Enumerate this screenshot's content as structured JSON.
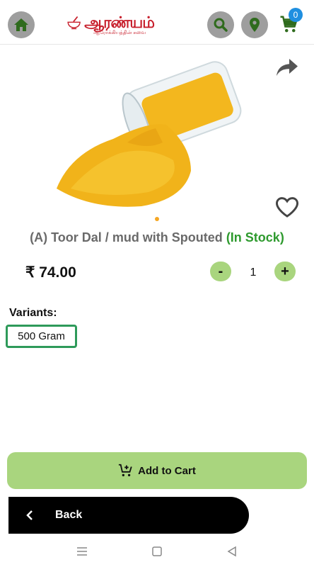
{
  "header": {
    "logo_text": "ஆரண்யம்",
    "logo_tagline": "ஆரோக்கியத்தின் சுவை",
    "cart_count": "0"
  },
  "product": {
    "title": "(A) Toor Dal / mud with Spouted",
    "stock": "(In Stock)",
    "price": "₹ 74.00",
    "quantity": "1",
    "minus_label": "-",
    "plus_label": "+"
  },
  "variants": {
    "label": "Variants:",
    "options": [
      "500 Gram"
    ]
  },
  "actions": {
    "add_to_cart": "Add to Cart",
    "back": "Back"
  },
  "colors": {
    "accent_green": "#a9d57e",
    "stock_green": "#2e9a2e",
    "brand_red": "#c71e2b",
    "badge_blue": "#1f8fe0"
  },
  "icons": [
    "home-icon",
    "search-icon",
    "location-pin-icon",
    "cart-icon",
    "share-icon",
    "heart-icon",
    "add-cart-icon",
    "chevron-left-icon"
  ]
}
